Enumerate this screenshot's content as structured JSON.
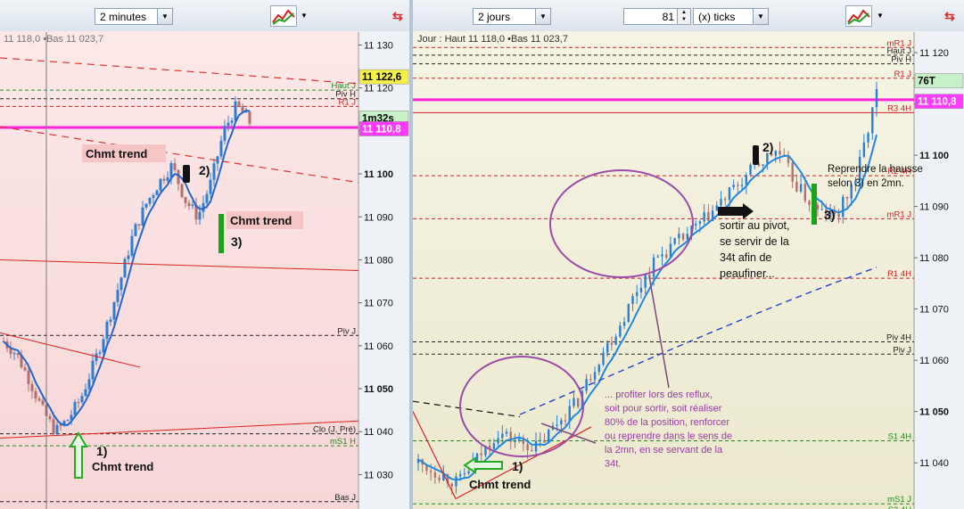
{
  "left": {
    "timeframe": "2 minutes",
    "info": "11 118,0 •Bas 11 023,7",
    "price_ticks": [
      "11 130",
      "11 120",
      "11 110",
      "11 100",
      "11 090",
      "11 080",
      "11 070",
      "11 060",
      "11 050",
      "11 040",
      "11 030"
    ],
    "levels": [
      {
        "label": "Haut J",
        "price": 11119.5,
        "color": "#1c8c1c",
        "style": "dash"
      },
      {
        "label": "Piv H",
        "price": 11117.5,
        "color": "#222222",
        "style": "dash"
      },
      {
        "label": "R1 J",
        "price": 11115.7,
        "color": "#cc2222",
        "style": "dash"
      },
      {
        "label": "Piv J",
        "price": 11062.4,
        "color": "#222222",
        "style": "dash"
      },
      {
        "label": "Clo (J, Pré)",
        "price": 11039.5,
        "color": "#222222",
        "style": "dash"
      },
      {
        "label": "mS1 H",
        "price": 11036.7,
        "color": "#1c8c1c",
        "style": "dash"
      },
      {
        "label": "Bas J",
        "price": 11023.7,
        "color": "#222222",
        "style": "dash"
      }
    ],
    "tags": [
      {
        "text": "11 122,6",
        "price": 11122.6,
        "bg": "#f5f14a",
        "fg": "#000000"
      },
      {
        "text": "1m32s",
        "price": 11113.0,
        "bg": "#c8f0c8",
        "fg": "#000000"
      },
      {
        "text": "11 110,8",
        "price": 11110.5,
        "bg": "#ff3bff",
        "fg": "#ffffff"
      }
    ],
    "annotations": {
      "trend1": "Chmt trend",
      "trend2": "Chmt trend",
      "trend3": "Chmt trend",
      "num1": "1)",
      "num2": "2)",
      "num3": "3)"
    }
  },
  "right": {
    "timeframe": "2 jours",
    "ticks_value": "81",
    "ticks_unit": "(x) ticks",
    "info": "Jour : Haut 11 118,0 •Bas 11 023,7",
    "price_ticks": [
      "11 120",
      "11 110",
      "11 100",
      "11 090",
      "11 080",
      "11 070",
      "11 060",
      "11 050",
      "11 040"
    ],
    "levels": [
      {
        "label": "mR1 J",
        "price": 11121.0,
        "color": "#cc2222",
        "style": "dash"
      },
      {
        "label": "Haut J",
        "price": 11119.5,
        "color": "#222222",
        "style": "dash"
      },
      {
        "label": "Piv H",
        "price": 11117.8,
        "color": "#222222",
        "style": "dash"
      },
      {
        "label": "R1 J",
        "price": 11115.0,
        "color": "#cc2222",
        "style": "dash"
      },
      {
        "label": "R3 4H",
        "price": 11108.3,
        "color": "#cc2222",
        "style": "solid"
      },
      {
        "label": "R2 4H",
        "price": 11096.0,
        "color": "#cc2222",
        "style": "dash"
      },
      {
        "label": "mR1 J",
        "price": 11087.6,
        "color": "#cc2222",
        "style": "dash"
      },
      {
        "label": "R1 4H",
        "price": 11076.0,
        "color": "#cc2222",
        "style": "dash"
      },
      {
        "label": "Piv 4H",
        "price": 11063.6,
        "color": "#222222",
        "style": "dash"
      },
      {
        "label": "Piv J",
        "price": 11061.2,
        "color": "#222222",
        "style": "dash"
      },
      {
        "label": "S1 4H",
        "price": 11044.3,
        "color": "#1c8c1c",
        "style": "dash"
      },
      {
        "label": "mS1 J",
        "price": 11032.0,
        "color": "#1c8c1c",
        "style": "dash"
      },
      {
        "label": "S2 4H",
        "price": 11030.0,
        "color": "#1c8c1c",
        "style": "dash"
      }
    ],
    "tags": [
      {
        "text": "76T",
        "price": 11114.5,
        "bg": "#c8f0c8",
        "fg": "#000000"
      },
      {
        "text": "11 110,8",
        "price": 11110.5,
        "bg": "#ff3bff",
        "fg": "#ffffff"
      }
    ],
    "annotations": {
      "trend1": "Chmt trend",
      "num1": "1)",
      "num2": "2)",
      "num3": "3)",
      "pivot_note": [
        "sortir au pivot,",
        "se servir de la",
        "34t afin de",
        "peaufiner..."
      ],
      "hausse_note": [
        "Reprendre la hausse",
        "selon 3) en 2mn."
      ],
      "reflux_note": [
        "... profiter lors des reflux,",
        "soit pour sortir, soit réaliser",
        "80% de la position, renforcer",
        "ou reprendre dans le sens de",
        "la 2mn, en se servant de la",
        "34t."
      ]
    }
  },
  "colors": {
    "candle_up": "#2c7fd0",
    "candle_down": "#b07070",
    "pink": "#ff22dd",
    "trendline": "#dd2222",
    "ellipse": "#9a4aa8",
    "note_text": "#9a3aa8"
  },
  "chart_data": [
    {
      "type": "line",
      "title": "",
      "x": [
        "t1",
        "t2",
        "t3",
        "t4",
        "t5",
        "t6",
        "t7",
        "t8",
        "t9",
        "t10",
        "t11",
        "t12",
        "t13",
        "t14",
        "t15",
        "t16",
        "t17",
        "t18",
        "t19",
        "t20"
      ],
      "series": [
        {
          "values": [
            11061,
            11058,
            11052,
            11045,
            11040,
            11043,
            11048,
            11056,
            11065,
            11075,
            11086,
            11093,
            11098,
            11102,
            11094,
            11090,
            11098,
            11110,
            11116,
            11112
          ]
        }
      ],
      "ylim": [
        11022,
        11133
      ],
      "xlabel": "",
      "ylabel": ""
    },
    {
      "type": "line",
      "title": "",
      "x": [
        "t1",
        "t2",
        "t3",
        "t4",
        "t5",
        "t6",
        "t7",
        "t8",
        "t9",
        "t10",
        "t11",
        "t12",
        "t13",
        "t14",
        "t15",
        "t16",
        "t17",
        "t18",
        "t19",
        "t20",
        "t21",
        "t22",
        "t23",
        "t24"
      ],
      "series": [
        {
          "values": [
            11040,
            11038,
            11036,
            11041,
            11046,
            11044,
            11043,
            11048,
            11052,
            11060,
            11066,
            11074,
            11080,
            11083,
            11086,
            11090,
            11094,
            11098,
            11101,
            11094,
            11089,
            11088,
            11096,
            11112
          ]
        }
      ],
      "ylim": [
        11031,
        11124
      ],
      "xlabel": "",
      "ylabel": ""
    }
  ]
}
